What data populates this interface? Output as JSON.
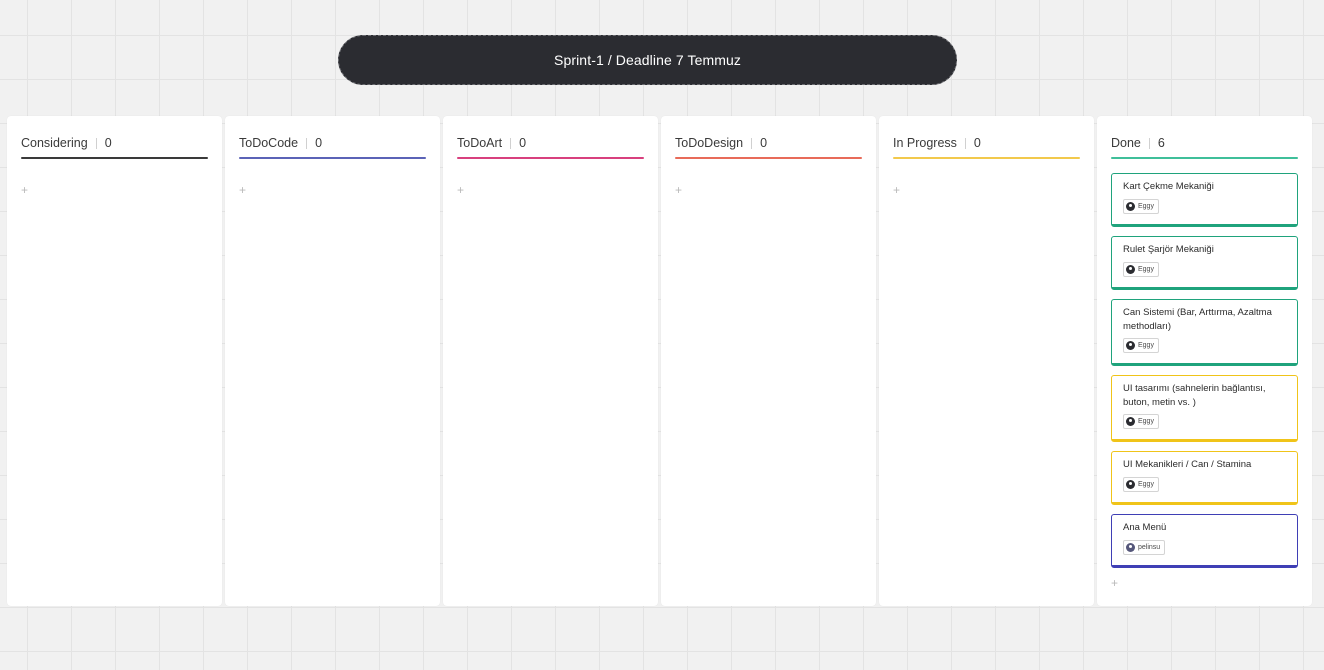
{
  "banner": {
    "title": "Sprint-1 / Deadline 7 Temmuz"
  },
  "columns": [
    {
      "name": "Considering",
      "count": "0",
      "color": "#3a3a3a"
    },
    {
      "name": "ToDoCode",
      "count": "0",
      "color": "#5b63b7"
    },
    {
      "name": "ToDoArt",
      "count": "0",
      "color": "#d8407e"
    },
    {
      "name": "ToDoDesign",
      "count": "0",
      "color": "#e86b59"
    },
    {
      "name": "In Progress",
      "count": "0",
      "color": "#f2c94c"
    },
    {
      "name": "Done",
      "count": "6",
      "color": "#3fbf9a"
    }
  ],
  "add_icon": "+",
  "done_cards": [
    {
      "title": "Kart Çekme Mekaniği",
      "assignee": "Eggy",
      "color": "#1fa37c"
    },
    {
      "title": "Rulet Şarjör Mekaniği",
      "assignee": "Eggy",
      "color": "#1fa37c"
    },
    {
      "title": "Can Sistemi (Bar, Arttırma, Azaltma methodları)",
      "assignee": "Eggy",
      "color": "#1fa37c"
    },
    {
      "title": "UI tasarımı (sahnelerin bağlantısı, buton, metin vs. )",
      "assignee": "Eggy",
      "color": "#f0c419"
    },
    {
      "title": "UI Mekanikleri / Can / Stamina",
      "assignee": "Eggy",
      "color": "#f0c419"
    },
    {
      "title": "Ana Menü",
      "assignee": "pelinsu",
      "color": "#3f3fb5"
    }
  ]
}
